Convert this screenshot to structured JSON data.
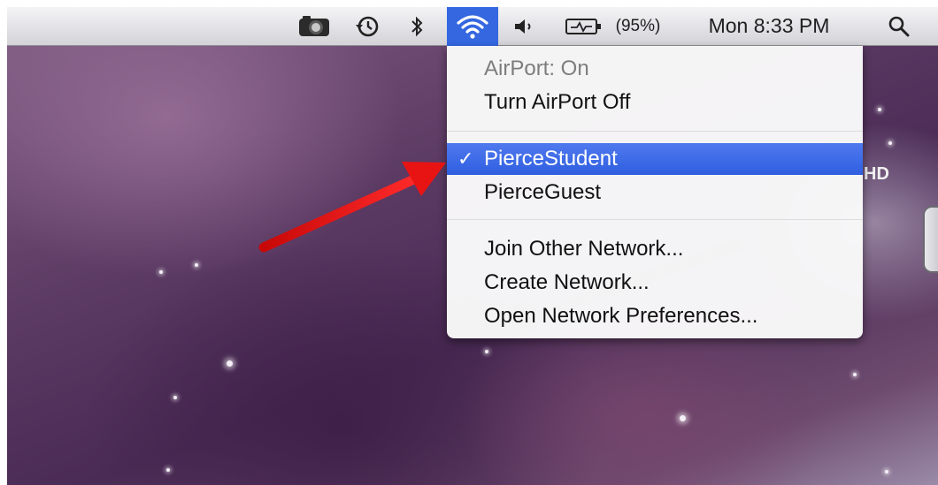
{
  "menubar": {
    "battery_percent": "(95%)",
    "clock": "Mon 8:33 PM"
  },
  "airport_menu": {
    "status": "AirPort: On",
    "toggle": "Turn AirPort Off",
    "networks": [
      {
        "name": "PierceStudent",
        "selected": true,
        "check": "✓"
      },
      {
        "name": "PierceGuest",
        "selected": false
      }
    ],
    "join_other": "Join Other Network...",
    "create": "Create Network...",
    "preferences": "Open Network Preferences..."
  },
  "desktop": {
    "drive_label_fragment": "HD"
  },
  "colors": {
    "highlight": "#3467e0",
    "arrow": "#e01010"
  },
  "icons": [
    "camera-icon",
    "time-machine-icon",
    "bluetooth-icon",
    "wifi-icon",
    "volume-icon",
    "battery-icon",
    "spotlight-search-icon",
    "checkmark-icon",
    "red-arrow-annotation"
  ]
}
